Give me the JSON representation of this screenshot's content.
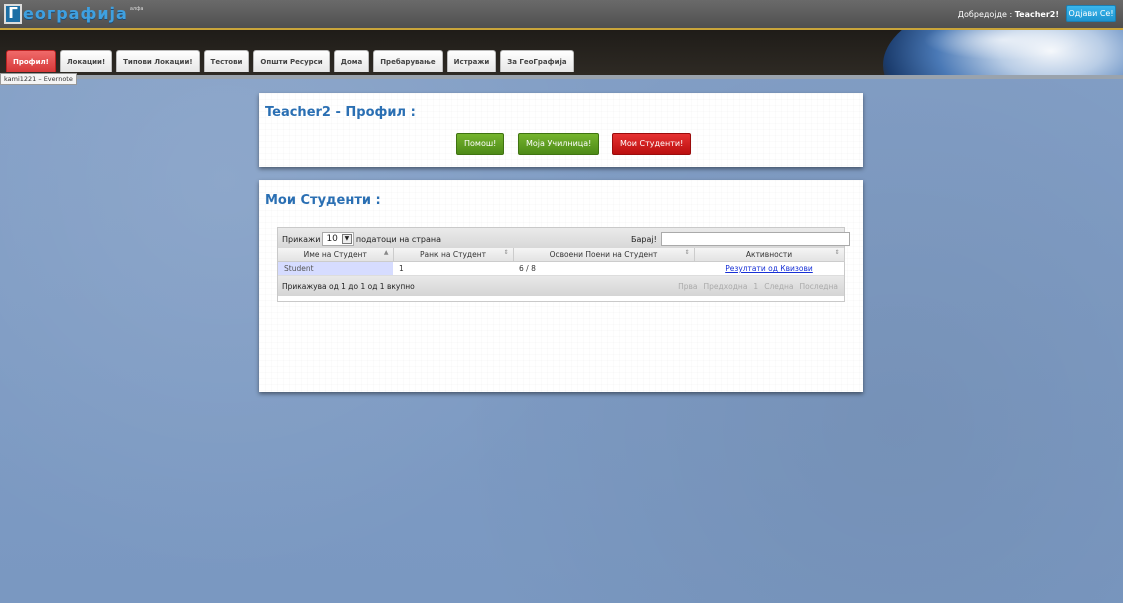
{
  "header": {
    "logo_letter": "Г",
    "logo_text": "еографија",
    "logo_sup": "алфа",
    "welcome_prefix": "Добредојде : ",
    "welcome_user": "Teacher2!",
    "logout_label": "Одјави Се!"
  },
  "nav": {
    "tabs": [
      {
        "label": "Профил!"
      },
      {
        "label": "Локации!"
      },
      {
        "label": "Типови Локации!"
      },
      {
        "label": "Тестови"
      },
      {
        "label": "Општи Ресурси"
      },
      {
        "label": "Дома"
      },
      {
        "label": "Пребарување"
      },
      {
        "label": "Истражи"
      },
      {
        "label": "За ГеоГрафија"
      }
    ],
    "tooltip": "kami1221 – Evernote"
  },
  "profile": {
    "title": "Teacher2 - Профил :",
    "buttons": {
      "help": "Помош!",
      "school": "Моја Училница!",
      "students": "Мои Студенти!"
    }
  },
  "students": {
    "title": "Мои Студенти :",
    "length_prefix": "Прикажи",
    "length_value": "10",
    "length_suffix": "податоци на страна",
    "search_label": "Барај!",
    "search_value": "",
    "columns": [
      "Име на Студент",
      "Ранк на Студент",
      "Освоени Поени на Студент",
      "Активности"
    ],
    "rows": [
      {
        "name": "Student",
        "rank": "1",
        "points": "6 / 8",
        "activity": "Резултати од Квизови"
      }
    ],
    "info": "Прикажува од 1 до 1 од 1 вкупно",
    "pager": {
      "first": "Прва",
      "prev": "Предходна",
      "page": "1",
      "next": "Следна",
      "last": "Последна"
    }
  },
  "colors": {
    "accent": "#2a6fb3",
    "active_tab": "#d63838",
    "green_button": "#5d9b1f",
    "red_button": "#cc1a1a",
    "logout": "#2aa5e0"
  }
}
